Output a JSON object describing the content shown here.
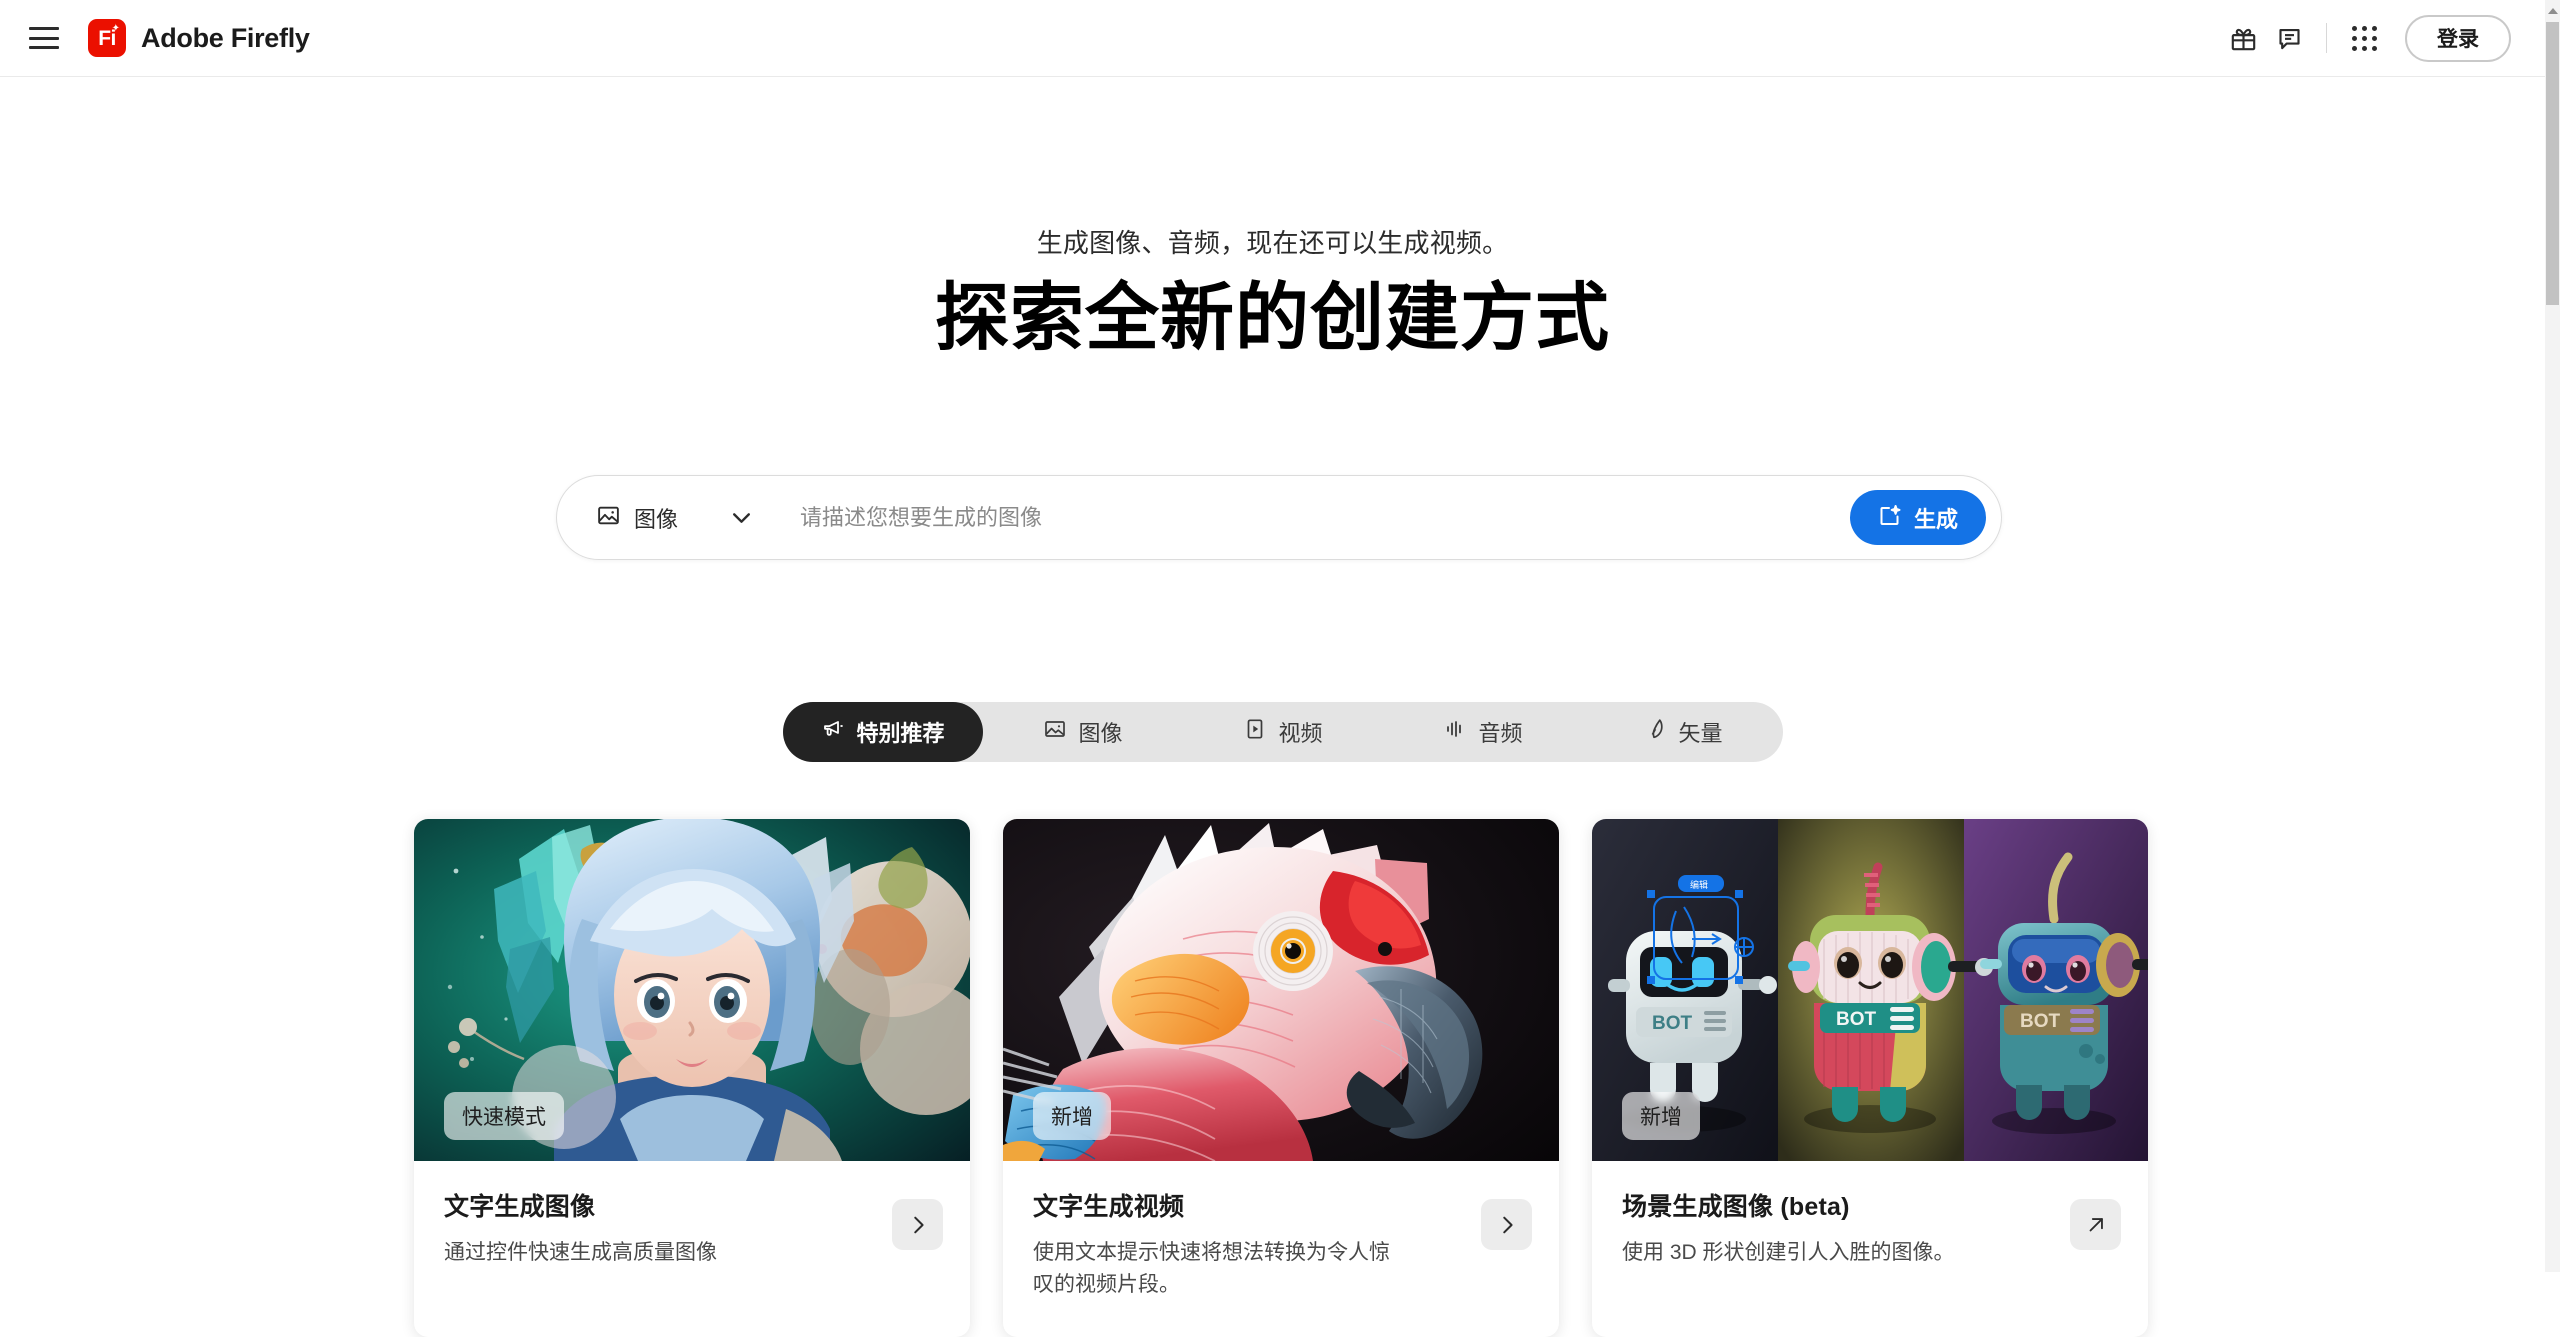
{
  "header": {
    "menu_icon": "hamburger-menu-icon",
    "logo_text": "Fi",
    "brand": "Adobe Firefly",
    "icons": [
      {
        "name": "gift-icon",
        "label": "Gift"
      },
      {
        "name": "feedback-chat-icon",
        "label": "Feedback"
      },
      {
        "name": "app-grid-icon",
        "label": "Apps"
      }
    ],
    "login_label": "登录"
  },
  "hero": {
    "subtitle": "生成图像、音频，现在还可以生成视频。",
    "title": "探索全新的创建方式"
  },
  "prompt": {
    "mode_icon": "image-icon",
    "mode_label": "图像",
    "caret_icon": "chevron-down-icon",
    "placeholder": "请描述您想要生成的图像",
    "value": "",
    "generate_label": "生成",
    "generate_icon": "sparkle-generate-icon",
    "accent_color": "#1473e6"
  },
  "tabs": [
    {
      "label": "特别推荐",
      "icon": "megaphone-icon",
      "active": true
    },
    {
      "label": "图像",
      "icon": "image-icon",
      "active": false
    },
    {
      "label": "视频",
      "icon": "video-play-icon",
      "active": false
    },
    {
      "label": "音频",
      "icon": "audio-waveform-icon",
      "active": false
    },
    {
      "label": "矢量",
      "icon": "pen-vector-icon",
      "active": false
    }
  ],
  "cards": [
    {
      "badge": "快速模式",
      "title": "文字生成图像",
      "description": "通过控件快速生成高质量图像",
      "action_icon": "chevron-right-icon",
      "art": "anime-girl-blue-hair"
    },
    {
      "badge": "新增",
      "title": "文字生成视频",
      "description": "使用文本提示快速将想法转换为令人惊叹的视频片段。",
      "action_icon": "chevron-right-icon",
      "art": "macaw-parrot"
    },
    {
      "badge": "新增",
      "title": "场景生成图像 (beta)",
      "description": "使用 3D 形状创建引人入胜的图像。",
      "action_icon": "external-link-icon",
      "art": "three-bot-robots"
    }
  ],
  "scrollbar": {
    "up_arrow_icon": "scroll-up-arrow-icon"
  },
  "colors": {
    "brand_red": "#eb1000",
    "accent_blue": "#1473e6",
    "tab_active_bg": "#232323",
    "tab_track_bg": "#e4e4e4"
  }
}
